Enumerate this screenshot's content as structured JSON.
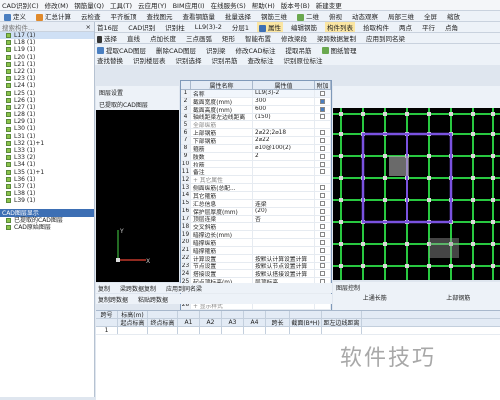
{
  "menubar": [
    "CAD识别(C)",
    "修改(M)",
    "钢筋量(Q)",
    "工具(T)",
    "云应用(Y)",
    "BIM应用(I)",
    "在线服务(S)",
    "帮助(H)",
    "版本号(B)",
    "新建变更"
  ],
  "toolbar1": [
    "定义",
    "汇总计算",
    "云检查",
    "平齐板顶",
    "查找图元",
    "查看钢筋量",
    "批量选择",
    "钢筋三维",
    "二维",
    "俯视",
    "动态观察",
    "局部三维",
    "全屏",
    "缩放"
  ],
  "toolbar2": [
    "首16层",
    "CAD识别",
    "识别柱",
    "LL9(3)-2",
    "分层1",
    "属性",
    "编辑钢筋",
    "构件列表",
    "拾取构件",
    "两点",
    "平行",
    "点角"
  ],
  "toolbar3": [
    "选择",
    "直线",
    "点加长度",
    "三点画弧",
    "矩形",
    "智能布置",
    "修改梁段",
    "梁跨数据复制",
    "应用到同名梁"
  ],
  "toolbar4": [
    "提取CAD图层",
    "删除CAD图层",
    "识别梁",
    "修改CAD标注",
    "提取吊筋",
    "图纸管理"
  ],
  "toolbar5": [
    "查找替换",
    "识别楼层表",
    "识别选择",
    "识别吊筋",
    "查改标注",
    "识别原位标注"
  ],
  "sidebar": {
    "title": "搜索构件...",
    "items": [
      "L17 (1)",
      "L18 (1)",
      "L19 (1)",
      "L20 (1)",
      "L21 (1)",
      "L22 (1)",
      "L23 (1)",
      "L24 (1)",
      "L25 (1)",
      "L26 (1)",
      "L27 (1)",
      "L28 (1)",
      "L29 (1)",
      "L30 (1)",
      "L31 (1)",
      "L32 (1)+1",
      "L33 (1)",
      "L33 (2)",
      "L34 (1)",
      "L35 (1)+1",
      "L36 (1)",
      "L37 (1)",
      "L38 (1)",
      "L39 (1)"
    ],
    "layers_title": "CAD图层显示",
    "layers": [
      "已提取的CAD图层",
      "CAD原始图层"
    ]
  },
  "left_canvas": {
    "tabs": [
      "图层设置",
      "已提取的CAD图层"
    ],
    "axis_y": "Y",
    "axis_x": "X"
  },
  "props": {
    "headers": [
      "属性名称",
      "属性值",
      "附加"
    ],
    "rows": [
      {
        "n": "1",
        "name": "名称",
        "val": "LL9(3)-2",
        "chk": false,
        "hl": true
      },
      {
        "n": "2",
        "name": "截面宽度(mm)",
        "val": "300",
        "chk": true
      },
      {
        "n": "3",
        "name": "截面高度(mm)",
        "val": "600",
        "chk": true
      },
      {
        "n": "4",
        "name": "轴线距梁左边线距离",
        "val": "(150)",
        "chk": false
      },
      {
        "n": "5",
        "name": "全部纵筋",
        "val": "",
        "chk": false,
        "group": true
      },
      {
        "n": "6",
        "name": "上部钢筋",
        "val": "2⌀22;2⌀18",
        "chk": false
      },
      {
        "n": "7",
        "name": "下部钢筋",
        "val": "2⌀22",
        "chk": false
      },
      {
        "n": "8",
        "name": "箍筋",
        "val": "⌀10@100(2)",
        "chk": false
      },
      {
        "n": "9",
        "name": "肢数",
        "val": "2",
        "chk": false
      },
      {
        "n": "10",
        "name": "拉筋",
        "val": "",
        "chk": false
      },
      {
        "n": "11",
        "name": "备注",
        "val": "",
        "chk": false
      },
      {
        "n": "12",
        "name": "+ 其它属性",
        "val": "",
        "chk": false,
        "group": true
      },
      {
        "n": "13",
        "name": "侧面纵筋(总配...",
        "val": "",
        "chk": false
      },
      {
        "n": "14",
        "name": "其它箍筋",
        "val": "",
        "chk": false
      },
      {
        "n": "15",
        "name": "汇总信息",
        "val": "连梁",
        "chk": false
      },
      {
        "n": "16",
        "name": "保护层厚度(mm)",
        "val": "(20)",
        "chk": false
      },
      {
        "n": "17",
        "name": "顶层连梁",
        "val": "否",
        "chk": false
      },
      {
        "n": "18",
        "name": "交叉斜筋",
        "val": "",
        "chk": false
      },
      {
        "n": "19",
        "name": "暗撑边长(mm)",
        "val": "",
        "chk": false
      },
      {
        "n": "20",
        "name": "暗撑纵筋",
        "val": "",
        "chk": false
      },
      {
        "n": "21",
        "name": "暗撑箍筋",
        "val": "",
        "chk": false
      },
      {
        "n": "22",
        "name": "计算设置",
        "val": "按默认计算设置计算",
        "chk": false
      },
      {
        "n": "23",
        "name": "节点设置",
        "val": "按默认节点设置计算",
        "chk": false
      },
      {
        "n": "24",
        "name": "搭接设置",
        "val": "按默认搭接设置计算",
        "chk": false
      },
      {
        "n": "25",
        "name": "起点顶标高(m)",
        "val": "层顶标高",
        "chk": false
      },
      {
        "n": "26",
        "name": "终点顶标高(m)",
        "val": "层顶标高",
        "chk": false
      },
      {
        "n": "27",
        "name": "+ 锚固搭接",
        "val": "",
        "chk": false,
        "group": true
      },
      {
        "n": "28",
        "name": "+ 显示样式",
        "val": "",
        "chk": false,
        "group": true
      }
    ]
  },
  "bottom_bar": [
    "复制",
    "梁跨数据复制",
    "应用到同名梁"
  ],
  "bottom_bar2": [
    "复制跨数据",
    "粘贴跨数据"
  ],
  "grid": {
    "head1": [
      "跨号",
      "标高(m)",
      "",
      "",
      "",
      "",
      "",
      "",
      "",
      ""
    ],
    "head2": [
      "",
      "起点标高",
      "终点标高",
      "A1",
      "A2",
      "A3",
      "A4",
      "跨长",
      "截面(B*H)",
      "距左边线距离"
    ],
    "row1": [
      "1"
    ]
  },
  "right_lower": [
    "图层控制",
    "上通长筋",
    "上部钢筋"
  ],
  "watermark": "软件技巧"
}
